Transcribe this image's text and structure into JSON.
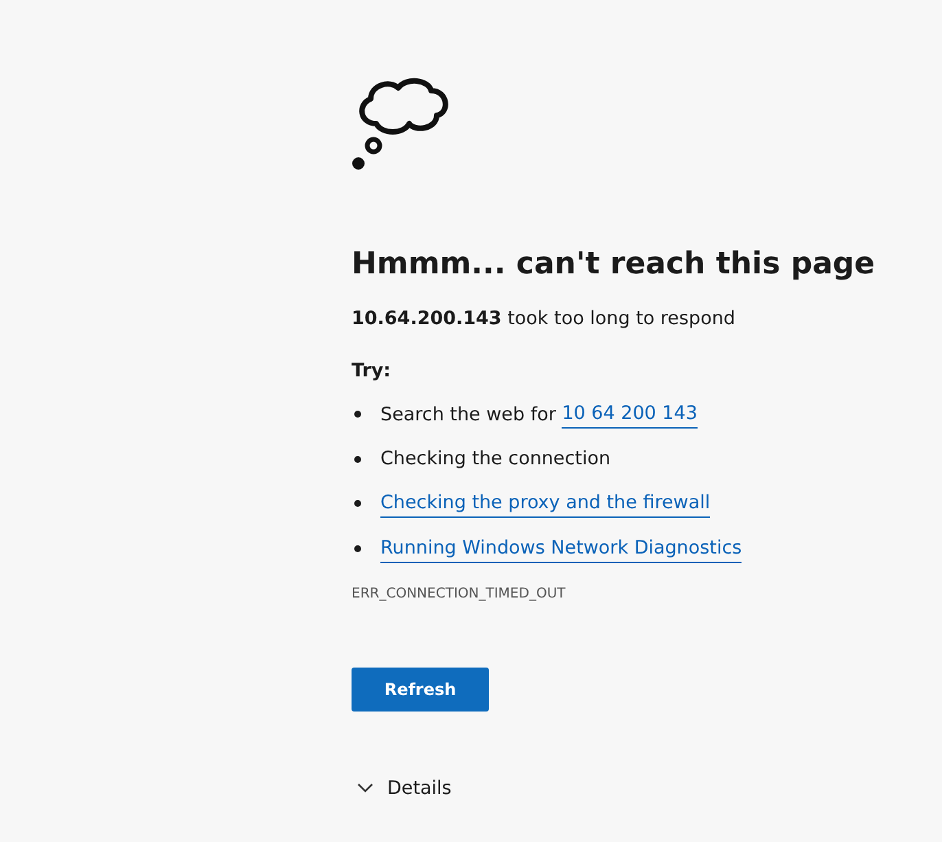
{
  "error": {
    "title": "Hmmm... can't reach this page",
    "message": "**10.64.200.143** took too long to respond",
    "try_heading": "Try:",
    "suggestions": [
      {
        "kind": "text_link",
        "text": "Search the web for",
        "link": "10 64 200 143"
      },
      {
        "kind": "text",
        "text": "Checking the connection"
      },
      {
        "kind": "link",
        "link": "Checking the proxy and the firewall"
      },
      {
        "kind": "link",
        "link": "Running Windows Network Diagnostics"
      }
    ],
    "code": "ERR_CONNECTION_TIMED_OUT",
    "button": "Refresh",
    "details": {
      "label": "Details",
      "expanded": false
    }
  }
}
